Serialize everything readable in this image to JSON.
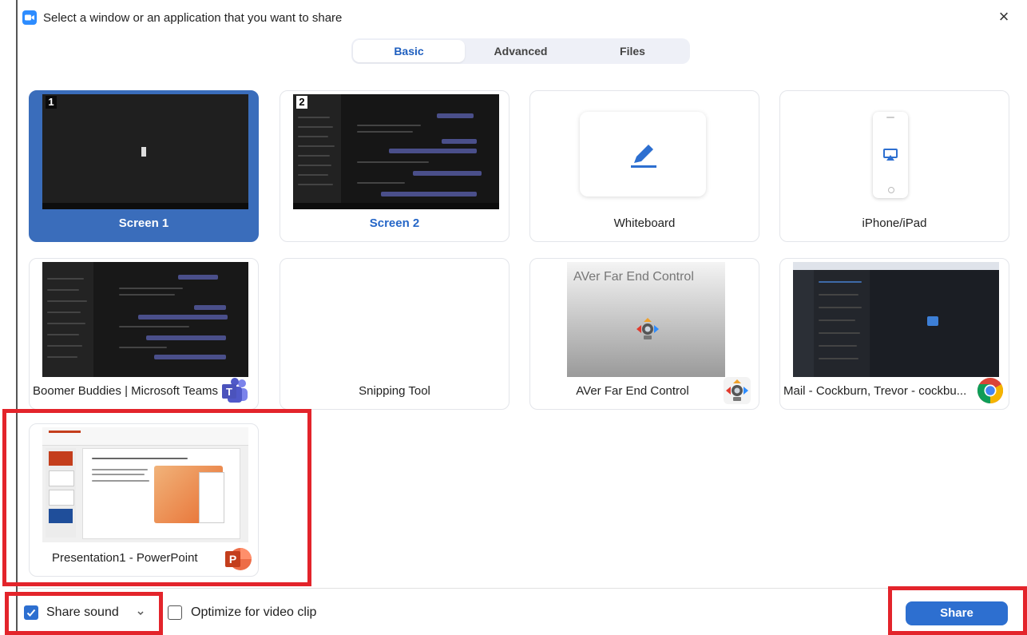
{
  "window": {
    "title": "Select a window or an application that you want to share",
    "close_glyph": "×"
  },
  "tabs": [
    {
      "label": "Basic",
      "active": true
    },
    {
      "label": "Advanced",
      "active": false
    },
    {
      "label": "Files",
      "active": false
    }
  ],
  "tiles": [
    {
      "label": "Screen 1",
      "selected": true,
      "thumb_number": "1"
    },
    {
      "label": "Screen 2",
      "selected": false,
      "thumb_number": "2"
    },
    {
      "label": "Whiteboard",
      "selected": false
    },
    {
      "label": "iPhone/iPad",
      "selected": false
    },
    {
      "label": "Boomer Buddies | Microsoft Teams",
      "selected": false
    },
    {
      "label": "Snipping Tool",
      "selected": false
    },
    {
      "label": "AVer Far End Control",
      "selected": false,
      "thumb_title": "AVer Far End Control"
    },
    {
      "label": "Mail - Cockburn, Trevor - cockbu...",
      "selected": false
    },
    {
      "label": "Presentation1 - PowerPoint",
      "selected": false
    }
  ],
  "footer": {
    "share_sound_label": "Share sound",
    "share_sound_checked": true,
    "optimize_label": "Optimize for video clip",
    "optimize_checked": false,
    "share_button": "Share"
  },
  "colors": {
    "accent": "#2d6fd0",
    "selected_tile": "#3a6dbb",
    "highlight": "#e3242b"
  }
}
